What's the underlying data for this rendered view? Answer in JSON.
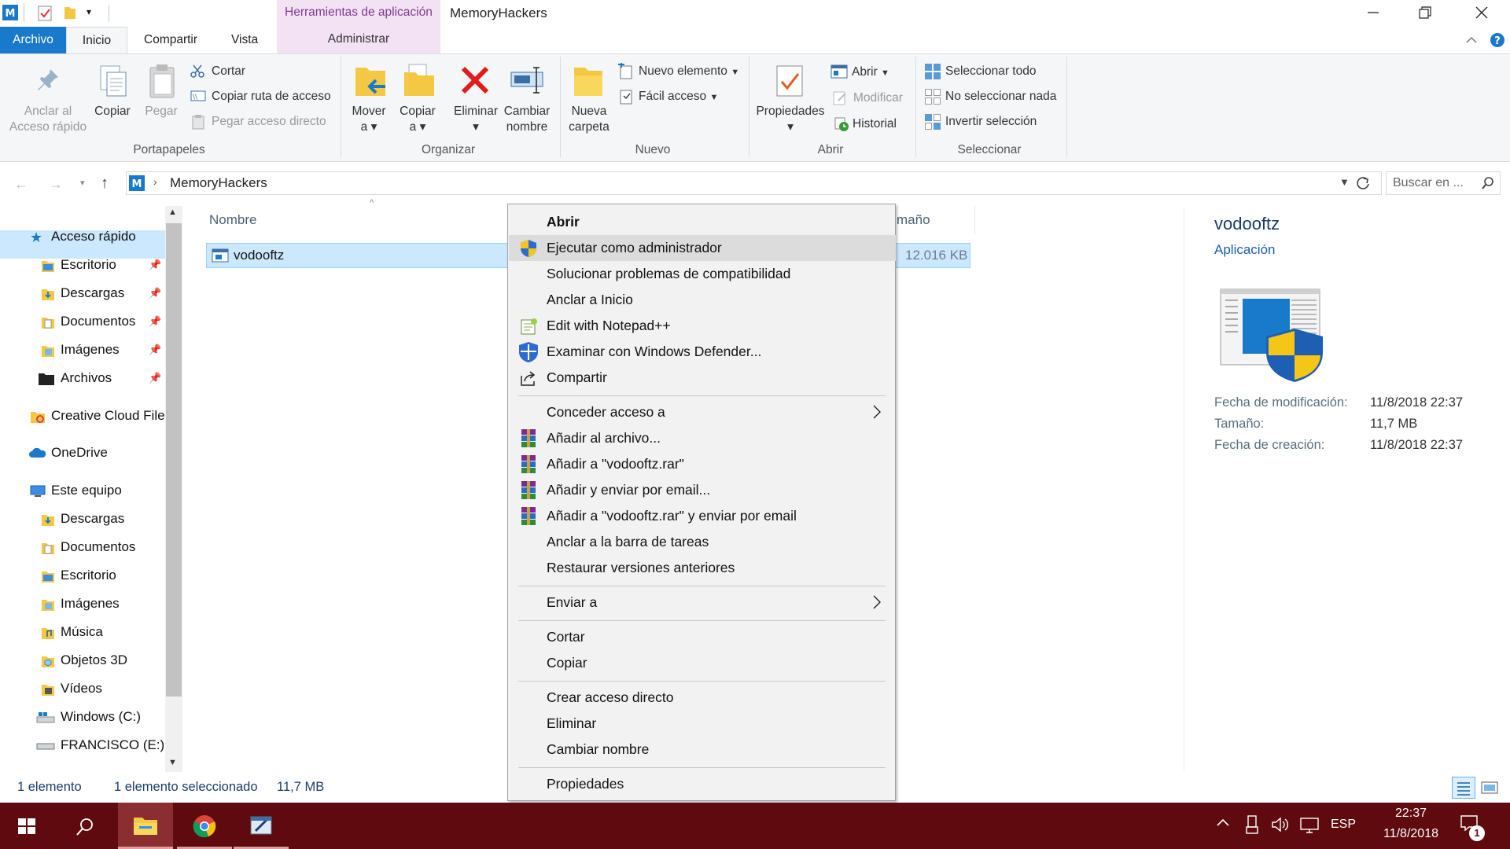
{
  "window": {
    "title": "MemoryHackers",
    "contextual_tab_group": "Herramientas de aplicación",
    "contextual_tab": "Administrar",
    "controls": {
      "minimize": "minimize-icon",
      "restore": "restore-icon",
      "close": "close-icon"
    }
  },
  "tabs": [
    {
      "label": "Archivo"
    },
    {
      "label": "Inicio"
    },
    {
      "label": "Compartir"
    },
    {
      "label": "Vista"
    }
  ],
  "ribbon": {
    "portapapeles": {
      "group": "Portapapeles",
      "anclar_line1": "Anclar al",
      "anclar_line2": "Acceso rápido",
      "copiar": "Copiar",
      "pegar": "Pegar",
      "cortar": "Cortar",
      "copiar_ruta": "Copiar ruta de acceso",
      "pegar_acceso": "Pegar acceso directo"
    },
    "organizar": {
      "group": "Organizar",
      "mover_line1": "Mover",
      "mover_line2": "a",
      "copiar_line1": "Copiar",
      "copiar_line2": "a",
      "eliminar": "Eliminar",
      "cambiar_line1": "Cambiar",
      "cambiar_line2": "nombre"
    },
    "nuevo": {
      "group": "Nuevo",
      "carpeta_line1": "Nueva",
      "carpeta_line2": "carpeta",
      "nuevo_elemento": "Nuevo elemento",
      "facil_acceso": "Fácil acceso"
    },
    "abrir": {
      "group": "Abrir",
      "propiedades": "Propiedades",
      "abrir": "Abrir",
      "modificar": "Modificar",
      "historial": "Historial"
    },
    "seleccionar": {
      "group": "Seleccionar",
      "todo": "Seleccionar todo",
      "nada": "No seleccionar nada",
      "invertir": "Invertir selección"
    }
  },
  "address": {
    "path": "MemoryHackers",
    "search_placeholder": "Buscar en ..."
  },
  "nav": {
    "items": [
      {
        "label": "Acceso rápido"
      },
      {
        "label": "Escritorio"
      },
      {
        "label": "Descargas"
      },
      {
        "label": "Documentos"
      },
      {
        "label": "Imágenes"
      },
      {
        "label": "Archivos"
      },
      {
        "label": "Creative Cloud Files"
      },
      {
        "label": "OneDrive"
      },
      {
        "label": "Este equipo"
      },
      {
        "label": "Descargas"
      },
      {
        "label": "Documentos"
      },
      {
        "label": "Escritorio"
      },
      {
        "label": "Imágenes"
      },
      {
        "label": "Música"
      },
      {
        "label": "Objetos 3D"
      },
      {
        "label": "Vídeos"
      },
      {
        "label": "Windows (C:)"
      },
      {
        "label": "FRANCISCO (E:)"
      }
    ]
  },
  "files": {
    "col_name": "Nombre",
    "col_size_partial": "maño",
    "rows": [
      {
        "name": "vodooftz",
        "size": "12.016 KB"
      }
    ]
  },
  "context_menu": {
    "items": [
      {
        "label": "Abrir"
      },
      {
        "label": "Ejecutar como administrador"
      },
      {
        "label": "Solucionar problemas de compatibilidad"
      },
      {
        "label": "Anclar a Inicio"
      },
      {
        "label": "Edit with Notepad++"
      },
      {
        "label": "Examinar con Windows Defender..."
      },
      {
        "label": "Compartir"
      },
      {
        "label": "Conceder acceso a"
      },
      {
        "label": "Añadir al archivo..."
      },
      {
        "label": "Añadir a \"vodooftz.rar\""
      },
      {
        "label": "Añadir y enviar por email..."
      },
      {
        "label": "Añadir a \"vodooftz.rar\" y enviar por email"
      },
      {
        "label": "Anclar a la barra de tareas"
      },
      {
        "label": "Restaurar versiones anteriores"
      },
      {
        "label": "Enviar a"
      },
      {
        "label": "Cortar"
      },
      {
        "label": "Copiar"
      },
      {
        "label": "Crear acceso directo"
      },
      {
        "label": "Eliminar"
      },
      {
        "label": "Cambiar nombre"
      },
      {
        "label": "Propiedades"
      }
    ]
  },
  "details": {
    "name": "vodooftz",
    "type": "Aplicación",
    "mod_label": "Fecha de modificación:",
    "mod_value": "11/8/2018 22:37",
    "size_label": "Tamaño:",
    "size_value": "11,7 MB",
    "created_label": "Fecha de creación:",
    "created_value": "11/8/2018 22:37"
  },
  "status": {
    "count": "1 elemento",
    "selected": "1 elemento seleccionado",
    "size": "11,7 MB"
  },
  "taskbar": {
    "lang": "ESP",
    "time": "22:37",
    "date": "11/8/2018",
    "notifications": "1",
    "accent": "#5e0a0e"
  },
  "colors": {
    "accent": "#1979ca",
    "selection": "#cce8ff",
    "link": "#1a5fa8"
  }
}
